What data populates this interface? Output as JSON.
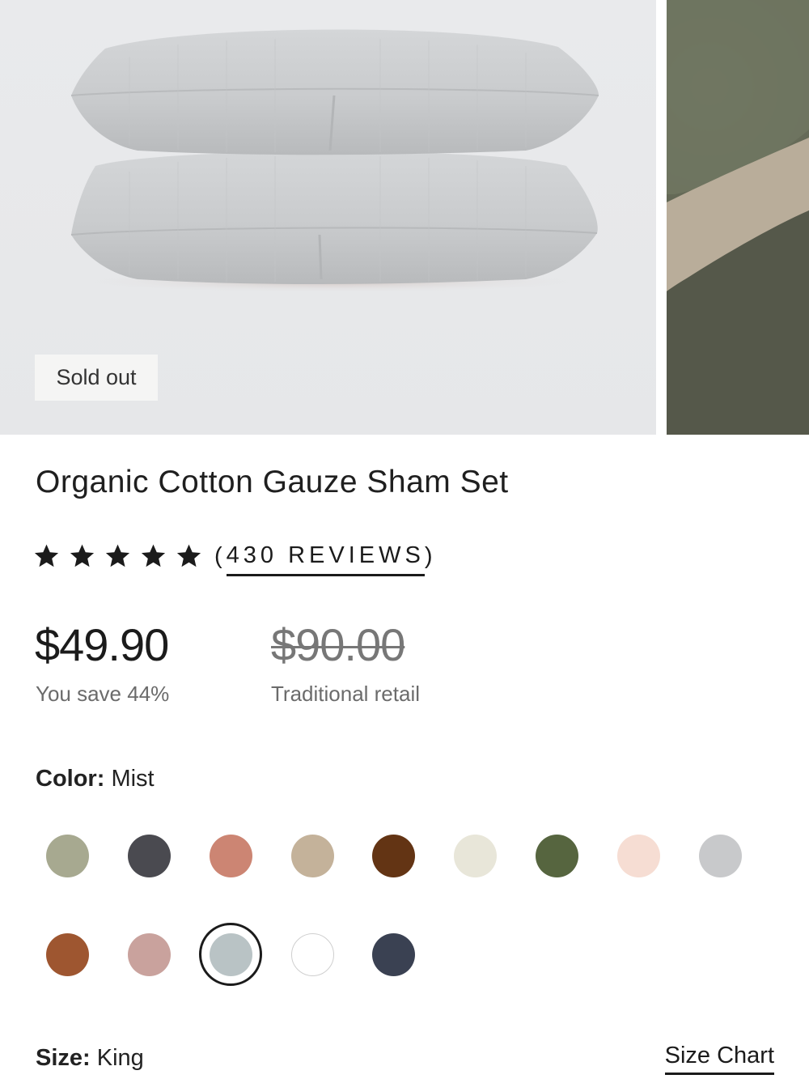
{
  "gallery": {
    "badge": "Sold out"
  },
  "product": {
    "title": "Organic Cotton Gauze Sham Set",
    "rating": {
      "stars": 5,
      "reviews_text": "430 REVIEWS"
    },
    "price": {
      "current": "$49.90",
      "savings": "You save 44%",
      "original": "$90.00",
      "original_note": "Traditional retail"
    }
  },
  "color": {
    "label": "Color:",
    "selected": "Mist",
    "swatches": [
      "#a7a990",
      "#4a4a50",
      "#cc8573",
      "#c4b29a",
      "#633414",
      "#e8e6d9",
      "#56653f",
      "#f6ddd3",
      "#c8c9cb",
      "#9e5630",
      "#c9a29d",
      "#b9c3c5",
      "#ffffff",
      "#3a4152"
    ]
  },
  "size": {
    "label": "Size:",
    "selected": "King",
    "chart_link": "Size Chart"
  }
}
